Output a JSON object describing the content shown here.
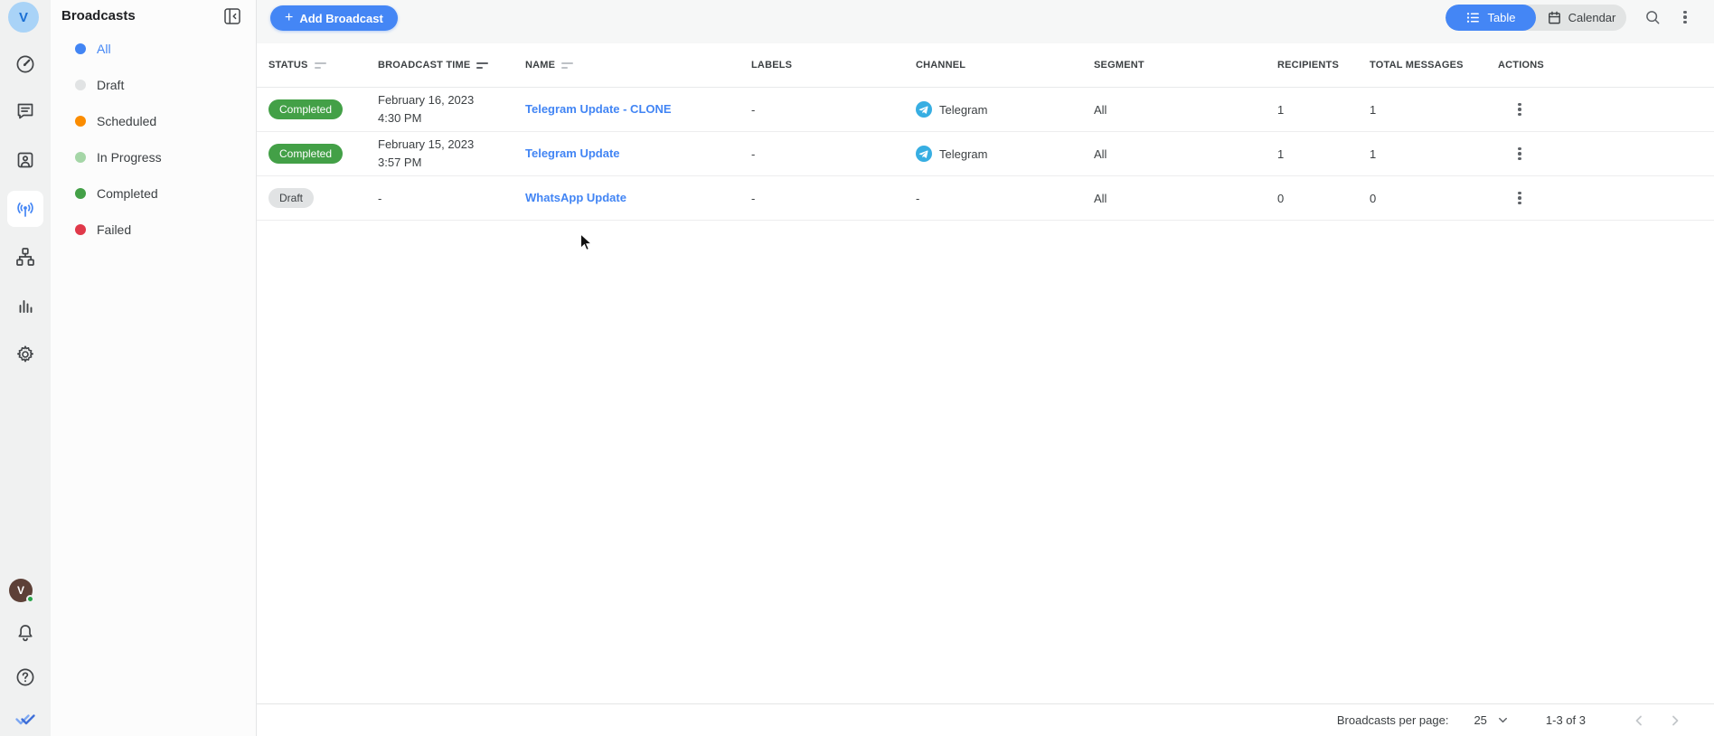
{
  "rail": {
    "workspace_initial": "V",
    "user_initial": "V"
  },
  "sidebar": {
    "title": "Broadcasts",
    "items": [
      {
        "label": "All",
        "color": "#4285f4",
        "active": true
      },
      {
        "label": "Draft",
        "color": "#e1e3e4",
        "active": false
      },
      {
        "label": "Scheduled",
        "color": "#fb8c00",
        "active": false
      },
      {
        "label": "In Progress",
        "color": "#a5d6a7",
        "active": false
      },
      {
        "label": "Completed",
        "color": "#43a047",
        "active": false
      },
      {
        "label": "Failed",
        "color": "#e0394a",
        "active": false
      }
    ]
  },
  "toolbar": {
    "plus": "+",
    "add_broadcast": "Add Broadcast",
    "table_view": "Table",
    "calendar_view": "Calendar"
  },
  "table": {
    "columns": {
      "status": "STATUS",
      "broadcast_time": "BROADCAST TIME",
      "name": "NAME",
      "labels": "LABELS",
      "channel": "CHANNEL",
      "segment": "SEGMENT",
      "recipients": "RECIPIENTS",
      "total_messages": "TOTAL MESSAGES",
      "actions": "ACTIONS"
    },
    "rows": [
      {
        "status": "Completed",
        "date": "February 16, 2023",
        "time": "4:30 PM",
        "name": "Telegram Update - CLONE",
        "labels": "-",
        "channel": "Telegram",
        "segment": "All",
        "recipients": "1",
        "total_messages": "1"
      },
      {
        "status": "Completed",
        "date": "February 15, 2023",
        "time": "3:57 PM",
        "name": "Telegram Update",
        "labels": "-",
        "channel": "Telegram",
        "segment": "All",
        "recipients": "1",
        "total_messages": "1"
      },
      {
        "status": "Draft",
        "date": "-",
        "time": "",
        "name": "WhatsApp Update",
        "labels": "-",
        "channel": "-",
        "segment": "All",
        "recipients": "0",
        "total_messages": "0"
      }
    ]
  },
  "pagination": {
    "per_page_label": "Broadcasts per page:",
    "per_page_value": "25",
    "range": "1-3 of 3"
  },
  "colors": {
    "accent_blue": "#4486f5",
    "link_blue": "#4285f4",
    "completed_green": "#43a047",
    "draft_gray": "#e1e3e4",
    "telegram_blue": "#37aee2",
    "rail_gray": "#f0f1f1"
  }
}
